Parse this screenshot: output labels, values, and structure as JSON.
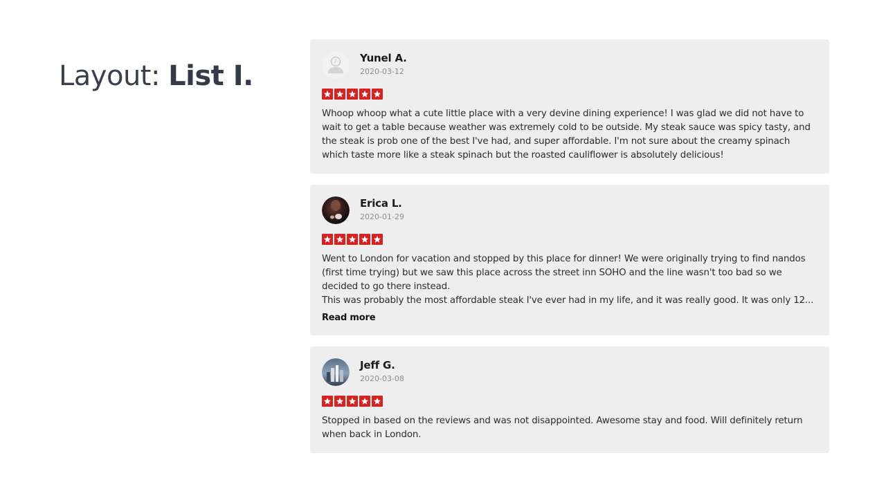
{
  "heading": {
    "prefix": "Layout: ",
    "emphasis": "List I."
  },
  "colors": {
    "star_bg": "#d32323",
    "card_bg": "#eeeeee",
    "heading": "#3a3f4b"
  },
  "reviews": [
    {
      "name": "Yunel A.",
      "date": "2020-03-12",
      "avatar": "default-avatar-icon",
      "rating": 5,
      "text": "Whoop whoop  what a cute little place with a very devine dining experience! I was glad we did not have to wait to get a table because weather was extremely cold to be outside. My steak sauce was spicy tasty, and the steak is prob one of the best I've had, and super affordable. I'm not sure about the creamy spinach which taste more like a steak spinach but the roasted cauliflower is absolutely delicious!"
    },
    {
      "name": "Erica L.",
      "date": "2020-01-29",
      "avatar": "user-photo",
      "rating": 5,
      "text": "Went to London for vacation and stopped by this  place for dinner! We were originally trying to find nandos (first time trying) but we saw this place across the street inn SOHO and the line wasn't too bad so we decided to go there instead.\nThis was probably the most affordable steak I've ever had in my life, and it was really good. It was only 12...",
      "read_more": "Read more"
    },
    {
      "name": "Jeff G.",
      "date": "2020-03-08",
      "avatar": "user-photo",
      "rating": 5,
      "text": "Stopped in based on the reviews and was not disappointed. Awesome stay and food. Will definitely return when back in London."
    }
  ]
}
